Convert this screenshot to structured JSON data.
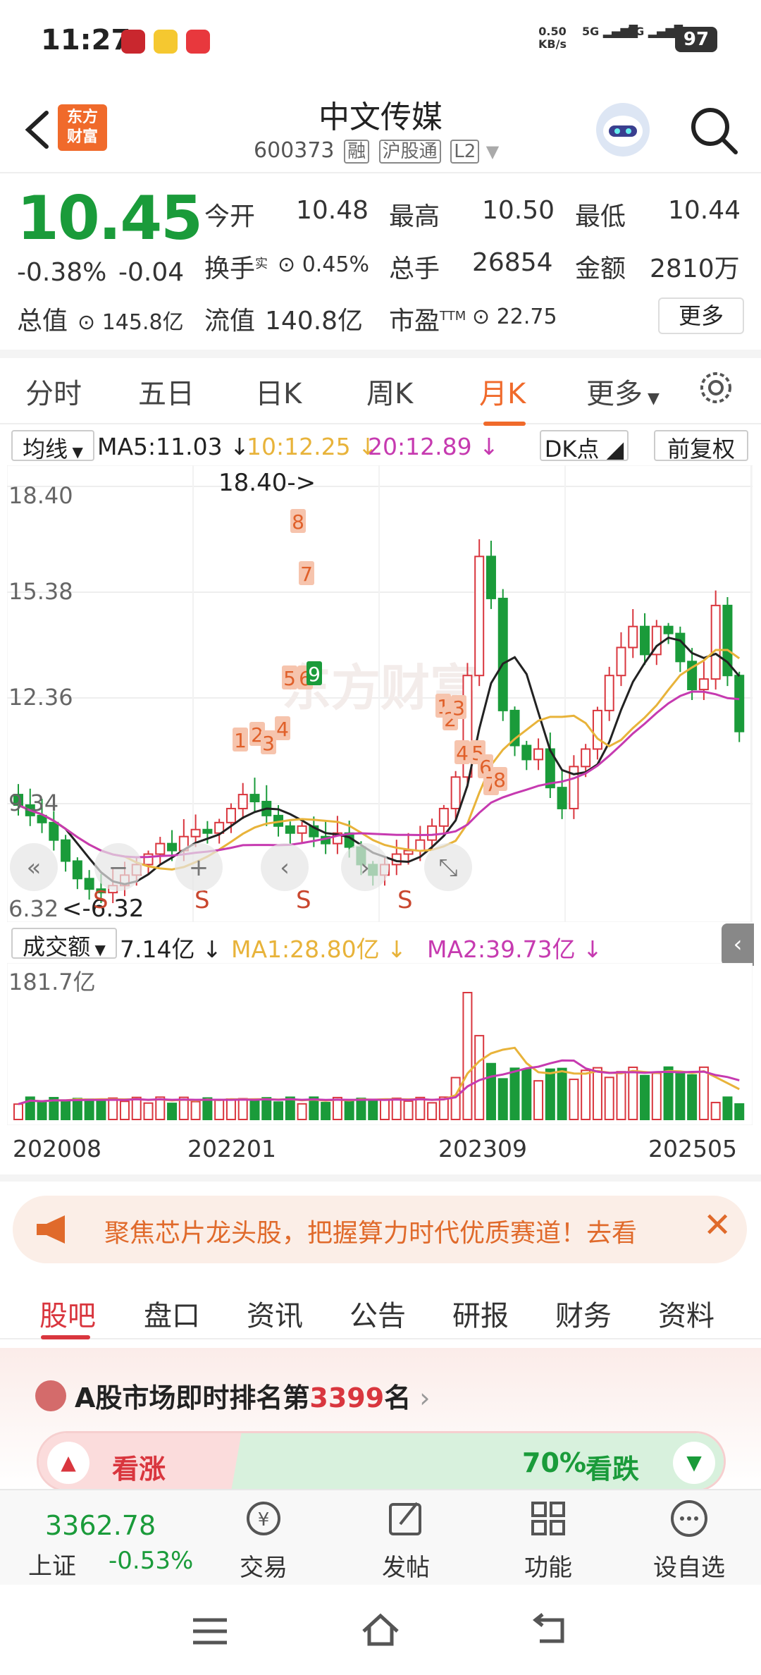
{
  "status_bar": {
    "time": "11:27",
    "net_speed": "0.50",
    "net_unit": "KB/s",
    "sig1": "5G",
    "sig2": "5G",
    "battery": "97"
  },
  "header": {
    "logo_line1": "东方",
    "logo_line2": "财富",
    "stock_name": "中文传媒",
    "stock_code": "600373",
    "tags": [
      "融",
      "沪股通",
      "L2"
    ]
  },
  "quote": {
    "price": "10.45",
    "change_pct": "-0.38%",
    "change": "-0.04",
    "open_label": "今开",
    "open": "10.48",
    "high_label": "最高",
    "high": "10.50",
    "low_label": "最低",
    "low": "10.44",
    "turnover_label": "换手",
    "turnover_sup": "实",
    "turnover": "0.45%",
    "volume_label": "总手",
    "volume": "26854",
    "amount_label": "金额",
    "amount": "2810万",
    "mktcap_label": "总值",
    "mktcap": "145.8亿",
    "float_label": "流值",
    "float": "140.8亿",
    "pe_label": "市盈",
    "pe_sup": "TTM",
    "pe": "22.75",
    "more": "更多"
  },
  "tabs": [
    "分时",
    "五日",
    "日K",
    "周K",
    "月K",
    "更多"
  ],
  "active_tab": "月K",
  "indicators": {
    "ma_select": "均线",
    "ma5": "MA5:11.03 ↓",
    "ma10": "10:12.25 ↓",
    "ma20": "20:12.89 ↓",
    "dk": "DK点",
    "fq": "前复权"
  },
  "chart_data": {
    "type": "candlestick",
    "y_ticks": [
      "18.40",
      "15.38",
      "12.36",
      "9.34",
      "6.32"
    ],
    "ylim": [
      6.32,
      18.4
    ],
    "max_label": "18.40->",
    "min_label": "<-6.32",
    "dates": [
      "202008",
      "202201",
      "202309",
      "202505"
    ],
    "volume_max": "181.7亿",
    "watermark": "东方财富",
    "markers": [
      "1",
      "2",
      "3",
      "4",
      "5",
      "6",
      "7",
      "8",
      "9",
      "1",
      "2",
      "3",
      "4",
      "5",
      "6",
      "7",
      "8",
      "S",
      "S",
      "S",
      "S"
    ],
    "colors": {
      "up": "#d9363e",
      "down": "#1a9b3a",
      "ma5": "#222222",
      "ma10": "#e8b33a",
      "ma20": "#c63ab0"
    }
  },
  "volume": {
    "select": "成交额",
    "value": "7.14亿 ↓",
    "ma1": "MA1:28.80亿 ↓",
    "ma2": "MA2:39.73亿 ↓"
  },
  "banner": {
    "text": "聚焦芯片龙头股，把握算力时代优质赛道！去看"
  },
  "bottom_tabs": [
    "股吧",
    "盘口",
    "资讯",
    "公告",
    "研报",
    "财务",
    "资料"
  ],
  "rank": {
    "prefix": "A股市场即时排名第",
    "number": "3399",
    "suffix": "名"
  },
  "vote": {
    "up": "看涨",
    "down_pct": "70%",
    "down": "看跌"
  },
  "bottom_nav": {
    "index_value": "3362.78",
    "index_name": "上证",
    "index_change": "-0.53%",
    "trade": "交易",
    "post": "发帖",
    "func": "功能",
    "watch": "设自选"
  }
}
